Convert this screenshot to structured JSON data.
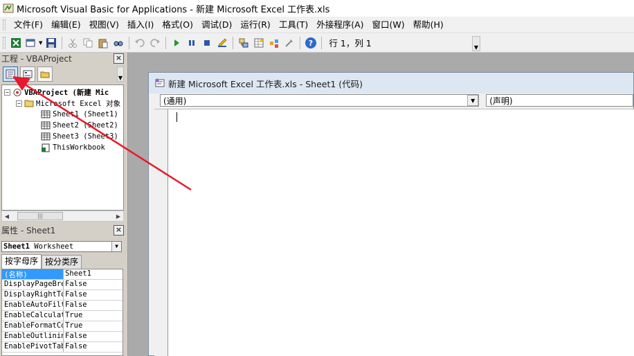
{
  "window": {
    "title": "Microsoft Visual Basic for Applications - 新建 Microsoft Excel 工作表.xls"
  },
  "menu": {
    "items": [
      {
        "label": "文件(F)"
      },
      {
        "label": "编辑(E)"
      },
      {
        "label": "视图(V)"
      },
      {
        "label": "插入(I)"
      },
      {
        "label": "格式(O)"
      },
      {
        "label": "调试(D)"
      },
      {
        "label": "运行(R)"
      },
      {
        "label": "工具(T)"
      },
      {
        "label": "外接程序(A)"
      },
      {
        "label": "窗口(W)"
      },
      {
        "label": "帮助(H)"
      }
    ]
  },
  "toolbar": {
    "status": "行 1，列 1",
    "icons": [
      "excel-icon",
      "insert-userform-icon",
      "save-icon",
      "cut-icon",
      "copy-icon",
      "paste-icon",
      "find-icon",
      "undo-icon",
      "redo-icon",
      "run-icon",
      "break-icon",
      "reset-icon",
      "design-mode-icon",
      "project-explorer-icon",
      "properties-window-icon",
      "object-browser-icon",
      "toolbox-icon",
      "help-icon"
    ]
  },
  "project_pane": {
    "title": "工程 - VBAProject",
    "close": "×",
    "tree": [
      {
        "label": "VBAProject (新建 Mic",
        "level": 0,
        "kind": "project"
      },
      {
        "label": "Microsoft Excel 对象",
        "level": 1,
        "kind": "folder"
      },
      {
        "label": "Sheet1 (Sheet1)",
        "level": 2,
        "kind": "sheet"
      },
      {
        "label": "Sheet2 (Sheet2)",
        "level": 2,
        "kind": "sheet"
      },
      {
        "label": "Sheet3 (Sheet3)",
        "level": 2,
        "kind": "sheet"
      },
      {
        "label": "ThisWorkbook",
        "level": 2,
        "kind": "workbook"
      }
    ]
  },
  "properties_pane": {
    "title": "属性 - Sheet1",
    "close": "×",
    "object_select": "Sheet1 Worksheet",
    "object_name": "Sheet1",
    "object_type": "Worksheet",
    "tabs": [
      "按字母序",
      "按分类序"
    ],
    "rows": [
      {
        "name": "(名称)",
        "value": "Sheet1"
      },
      {
        "name": "DisplayPageBre",
        "value": "False"
      },
      {
        "name": "DisplayRightTo",
        "value": "False"
      },
      {
        "name": "EnableAutoFilt",
        "value": "False"
      },
      {
        "name": "EnableCalculat",
        "value": "True"
      },
      {
        "name": "EnableFormatCo",
        "value": "True"
      },
      {
        "name": "EnableOutlinin",
        "value": "False"
      },
      {
        "name": "EnablePivotTab",
        "value": "False"
      }
    ]
  },
  "code_window": {
    "title": "新建 Microsoft Excel 工作表.xls - Sheet1 (代码)",
    "object_combo": "(通用)",
    "procedure_combo": "(声明)"
  },
  "colors": {
    "annotation_arrow": "#e8192c",
    "selection": "#3399ff"
  }
}
